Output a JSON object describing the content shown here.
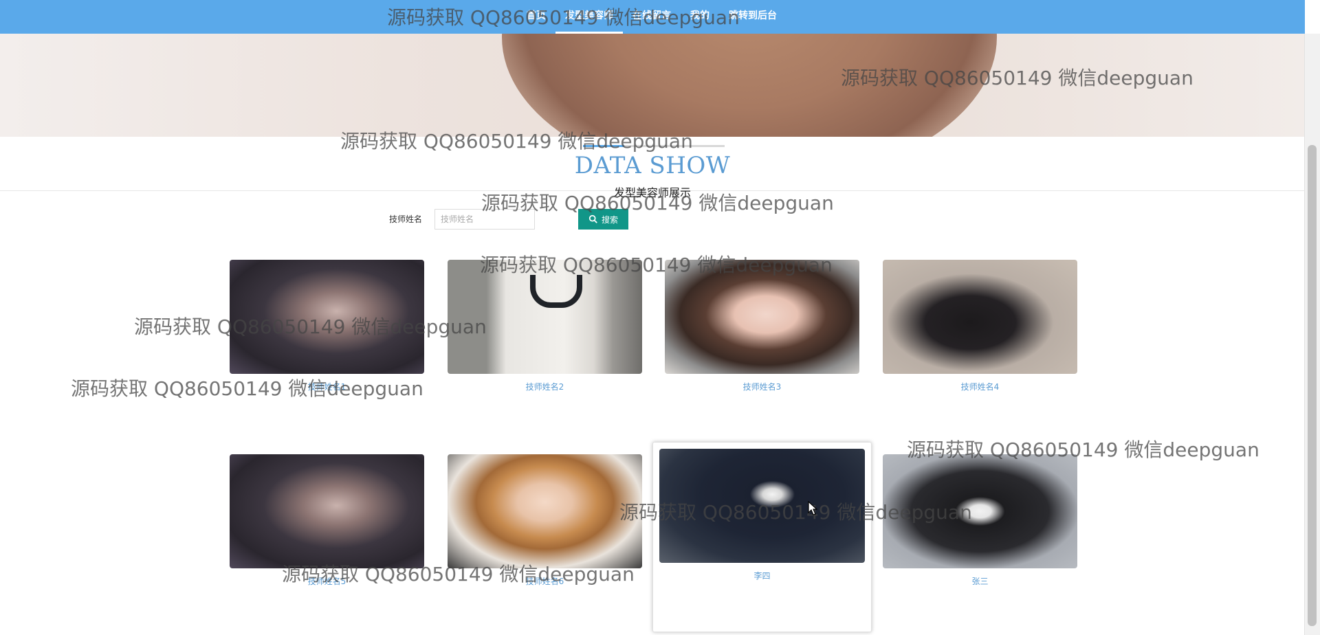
{
  "nav": {
    "items": [
      {
        "label": "首页",
        "active": false
      },
      {
        "label": "发型美容师",
        "active": true
      },
      {
        "label": "在线留言",
        "active": false
      },
      {
        "label": "我的",
        "active": false
      },
      {
        "label": "跳转到后台",
        "active": false
      }
    ]
  },
  "section": {
    "title": "DATA SHOW",
    "subtitle": "发型美容师展示"
  },
  "search": {
    "label": "技师姓名",
    "placeholder": "技师姓名",
    "button_label": "搜索"
  },
  "cards": [
    {
      "name": "技师姓名1",
      "photo": "man-dark"
    },
    {
      "name": "技师姓名2",
      "photo": "hoodie"
    },
    {
      "name": "技师姓名3",
      "photo": "woman1"
    },
    {
      "name": "技师姓名4",
      "photo": "woman2"
    },
    {
      "name": "技师姓名5",
      "photo": "man-dark"
    },
    {
      "name": "技师姓名6",
      "photo": "boy"
    },
    {
      "name": "李四",
      "photo": "suit"
    },
    {
      "name": "张三",
      "photo": "suitw"
    }
  ],
  "watermark": "源码获取 QQ86050149 微信deepguan",
  "colors": {
    "nav_bg": "#5aa9ea",
    "title": "#5a9bd2",
    "search_button": "#119688",
    "card_name": "#5a9bd2"
  }
}
